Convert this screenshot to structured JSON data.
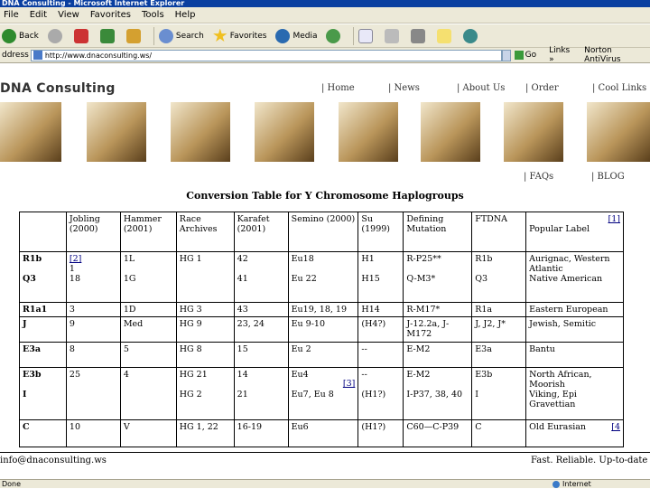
{
  "window": {
    "title": "DNA Consulting - Microsoft Internet Explorer"
  },
  "menu": [
    "File",
    "Edit",
    "View",
    "Favorites",
    "Tools",
    "Help"
  ],
  "toolbar": {
    "back": "Back",
    "search": "Search",
    "favorites": "Favorites",
    "media": "Media"
  },
  "address": {
    "label": "ddress",
    "url": "http://www.dnaconsulting.ws/",
    "go": "Go",
    "links": "Links »",
    "norton": "Norton AntiVirus"
  },
  "site": {
    "logo": "DNA Consulting",
    "nav": [
      "| Home",
      "| News",
      "| About Us",
      "| Order",
      "| Cool Links"
    ],
    "nav2": [
      "| FAQs",
      "| BLOG"
    ]
  },
  "table": {
    "caption": "Conversion Table for Y Chromosome Haplogroups",
    "headers": [
      "",
      "Jobling (2000)",
      "Hammer (2001)",
      "Race Archives",
      "Karafet (2001)",
      "Semino (2000)",
      "Su (1999)",
      "Defining Mutation",
      "FTDNA",
      "Popular Label"
    ],
    "header_fn": "[1]",
    "rows": [
      {
        "h": "R1b\n\nQ3",
        "c": [
          "[2]\n1\n18",
          "1L\n\n1G",
          "HG 1\n\n",
          "42\n\n41",
          "Eu18\n\nEu 22",
          "H1\n\nH15",
          "R-P25**\n\nQ-M3*",
          "R1b\n\nQ3",
          "Aurignac, Western Atlantic\nNative American"
        ]
      },
      {
        "h": "R1a1",
        "c": [
          "3",
          "1D",
          "HG 3",
          "43",
          "Eu19, 18, 19",
          "H14",
          "R-M17*",
          "R1a",
          "Eastern European"
        ]
      },
      {
        "h": "J",
        "c": [
          "9",
          "Med",
          "HG 9",
          "23, 24",
          "Eu 9-10",
          "(H4?)",
          "J-12.2a, J-M172",
          "J, J2, J*",
          "Jewish, Semitic"
        ]
      },
      {
        "h": "E3a",
        "c": [
          "8",
          "5",
          "HG 8",
          "15",
          "Eu 2",
          "--",
          "E-M2",
          "E3a",
          "Bantu"
        ]
      },
      {
        "h": "E3b\n\nI",
        "c": [
          "25\n\n",
          "4\n\n",
          "HG 21\n\nHG 2",
          "14\n\n21",
          "Eu4\n\nEu7, Eu 8",
          "--\n\n(H1?)",
          "E-M2\n\nI-P37, 38, 40",
          "E3b\n\nI",
          "North African, Moorish\nViking, Epi Gravettian"
        ]
      },
      {
        "h": "C",
        "c": [
          "10",
          "V",
          "HG 1, 22",
          "16-19",
          "Eu6",
          "(H1?)",
          "C60—C-P39",
          "C",
          "Old Eurasian"
        ]
      }
    ],
    "fn3": "[3]",
    "fn4": "[4"
  },
  "footer": {
    "email": "info@dnaconsulting.ws",
    "tagline": "Fast. Reliable. Up-to-date"
  },
  "status": {
    "left": "Done",
    "zone": "Internet"
  }
}
